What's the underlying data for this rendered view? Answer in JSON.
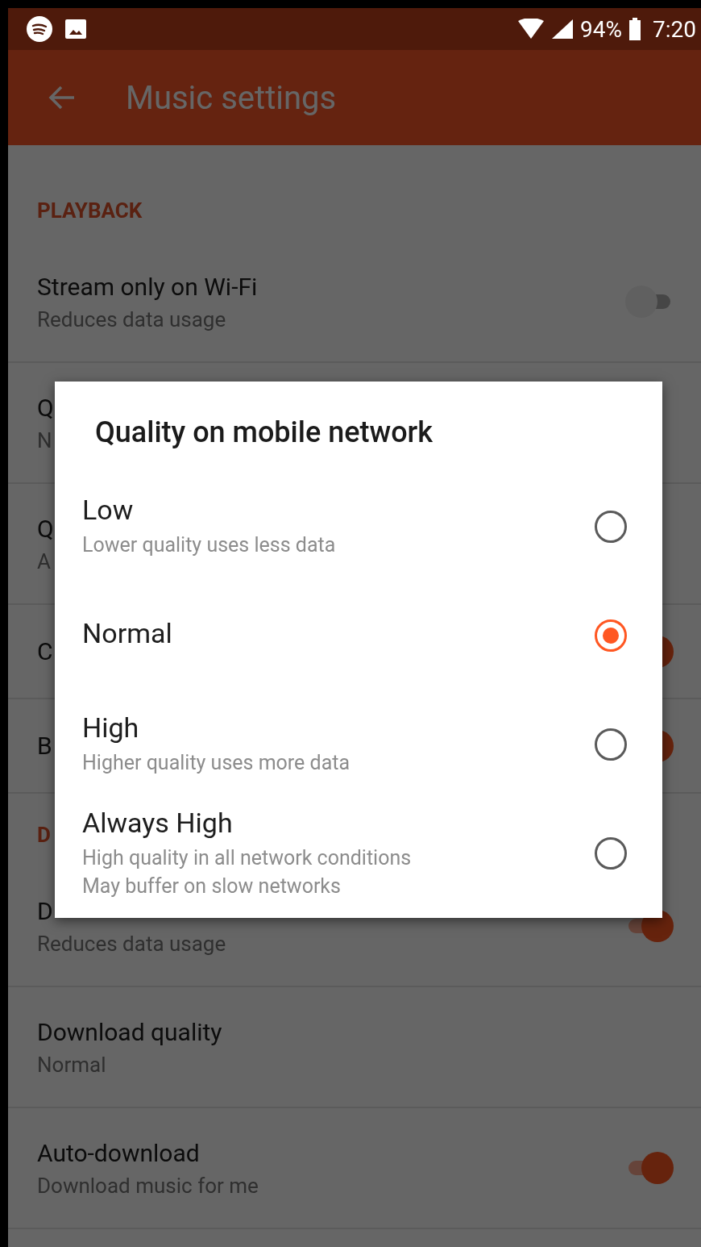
{
  "status_bar": {
    "battery": "94%",
    "time": "7:20"
  },
  "app_bar": {
    "title": "Music settings"
  },
  "settings": [
    {
      "kind": "section",
      "label": "PLAYBACK"
    },
    {
      "kind": "row",
      "title": "Stream only on Wi-Fi",
      "subtitle": "Reduces data usage",
      "toggle": {
        "on": false
      }
    },
    {
      "kind": "row",
      "title": "Q",
      "subtitle": "N"
    },
    {
      "kind": "row",
      "title": "Q",
      "subtitle": "A"
    },
    {
      "kind": "row",
      "title": "C",
      "toggle": {
        "on": true
      }
    },
    {
      "kind": "row",
      "title": "B",
      "toggle": {
        "on": true
      }
    },
    {
      "kind": "section",
      "label": "D"
    },
    {
      "kind": "row",
      "title": "D",
      "subtitle": "Reduces data usage",
      "toggle": {
        "on": true
      }
    },
    {
      "kind": "row",
      "title": "Download quality",
      "subtitle": "Normal"
    },
    {
      "kind": "row",
      "title": "Auto-download",
      "subtitle": "Download music for me",
      "toggle": {
        "on": true
      }
    }
  ],
  "dialog": {
    "title": "Quality on mobile network",
    "options": [
      {
        "label": "Low",
        "details": [
          "Lower quality uses less data"
        ],
        "selected": false
      },
      {
        "label": "Normal",
        "selected": true
      },
      {
        "label": "High",
        "details": [
          "Higher quality uses more data"
        ],
        "selected": false
      },
      {
        "label": "Always High",
        "details": [
          "High quality in all network conditions",
          "May buffer on slow networks"
        ],
        "selected": false
      }
    ]
  }
}
